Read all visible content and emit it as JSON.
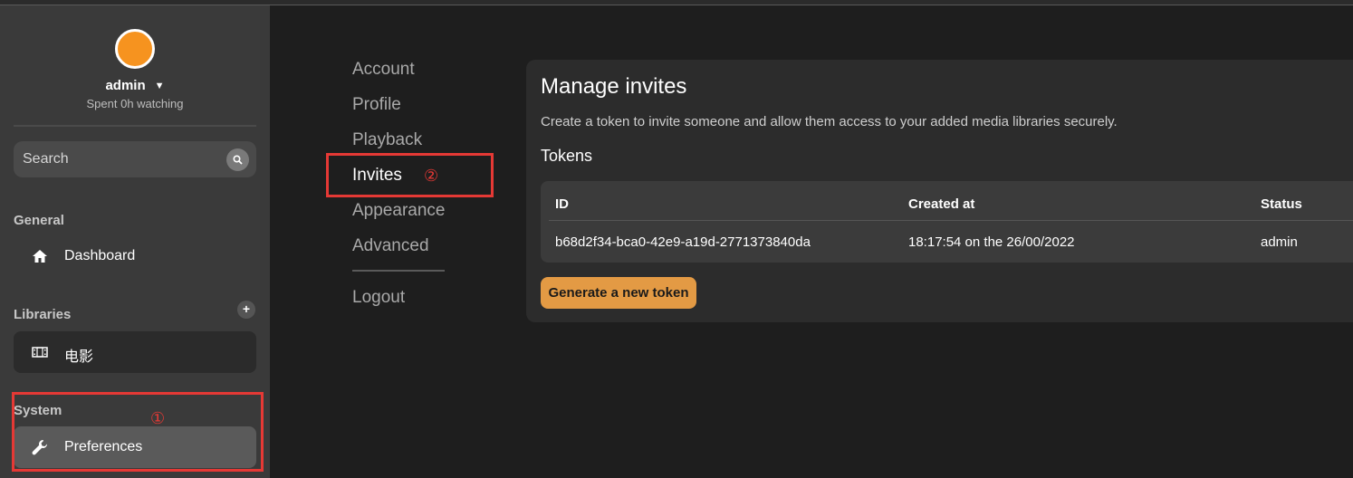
{
  "user": {
    "name": "admin",
    "watching": "Spent 0h watching",
    "avatar_color": "#f6931f"
  },
  "search": {
    "placeholder": "Search"
  },
  "sidebar": {
    "general_label": "General",
    "dashboard_label": "Dashboard",
    "libraries_label": "Libraries",
    "library_items": [
      "电影"
    ],
    "system_label": "System",
    "preferences_label": "Preferences"
  },
  "settings_menu": {
    "items": [
      "Account",
      "Profile",
      "Playback",
      "Invites",
      "Appearance",
      "Advanced"
    ],
    "active": "Invites",
    "logout_label": "Logout"
  },
  "invites": {
    "title": "Manage invites",
    "description": "Create a token to invite someone and allow them access to your added media libraries securely.",
    "tokens_heading": "Tokens",
    "table": {
      "headers": [
        "ID",
        "Created at",
        "Status"
      ],
      "rows": [
        [
          "b68d2f34-bca0-42e9-a19d-2771373840da",
          "18:17:54 on the 26/00/2022",
          "admin"
        ]
      ]
    },
    "generate_label": "Generate a new token"
  },
  "annotations": {
    "marker_1": "①",
    "marker_2": "②",
    "color": "#e53935"
  },
  "colors": {
    "accent_button": "#e39a44",
    "sidebar_bg": "#3a3a3a",
    "page_bg": "#1e1e1e"
  }
}
